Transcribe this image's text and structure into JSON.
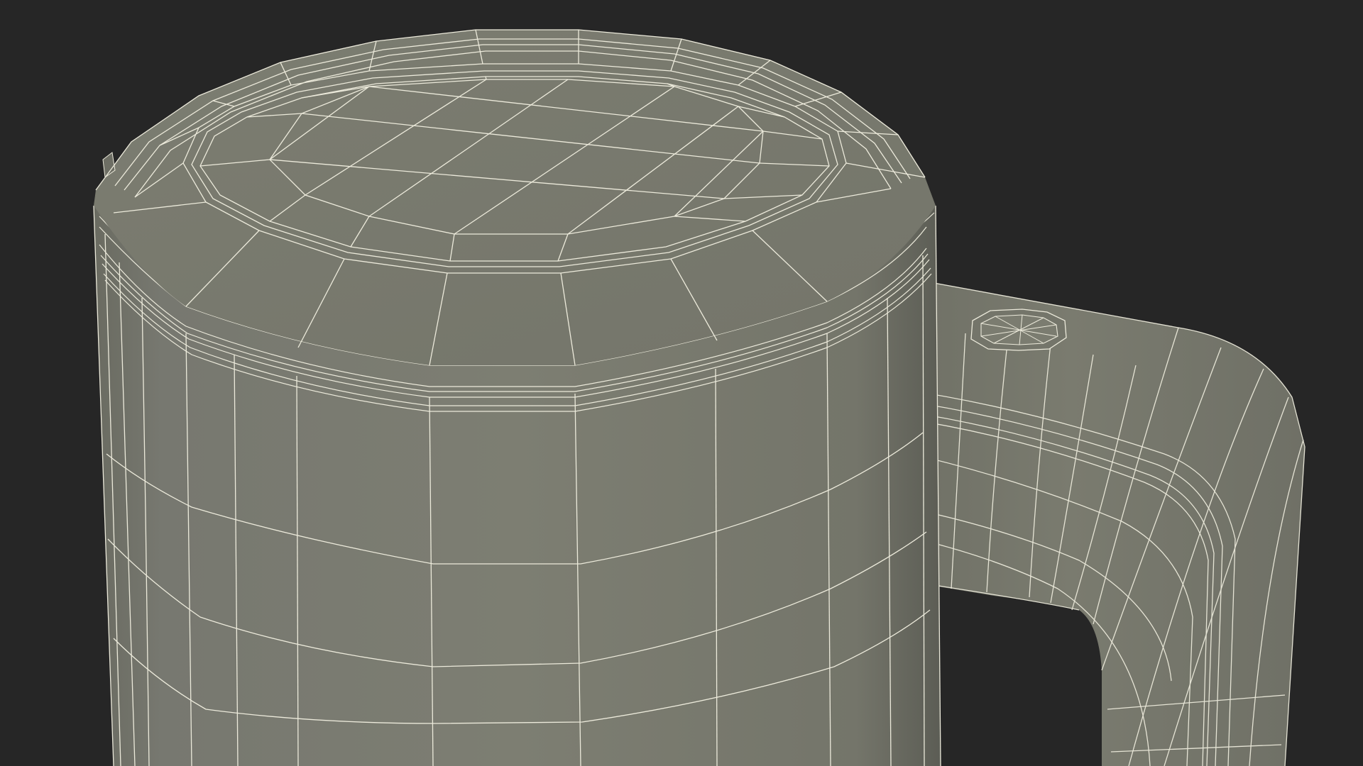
{
  "scene": {
    "subject": "wireframe-mug-with-lid",
    "background_color": "#262626",
    "surface_color": "#7a7b6f",
    "surface_shadow_color": "#5f6058",
    "wire_color": "#eceadb",
    "render_style": "clay-shaded-with-wireframe-overlay"
  }
}
